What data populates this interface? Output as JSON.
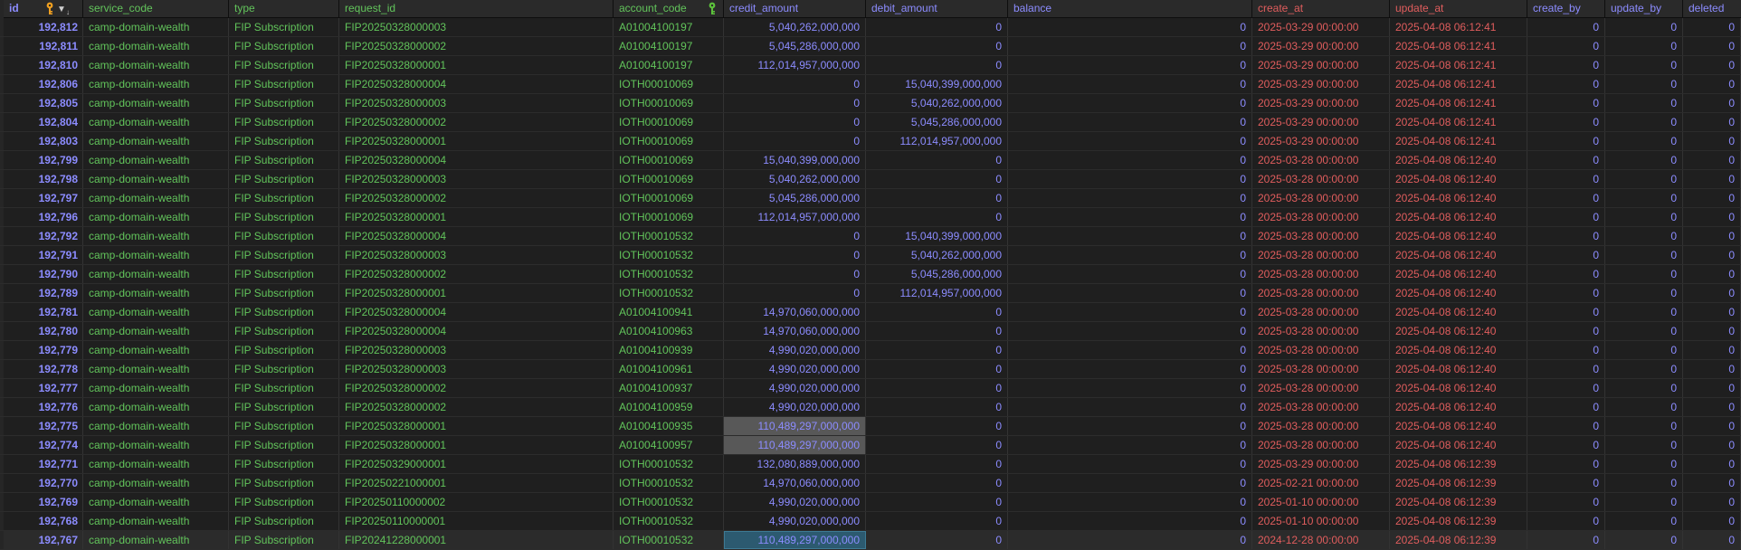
{
  "columns": [
    {
      "key": "id",
      "label": "id"
    },
    {
      "key": "service_code",
      "label": "service_code"
    },
    {
      "key": "type",
      "label": "type"
    },
    {
      "key": "request_id",
      "label": "request_id"
    },
    {
      "key": "account_code",
      "label": "account_code"
    },
    {
      "key": "credit_amount",
      "label": "credit_amount"
    },
    {
      "key": "debit_amount",
      "label": "debit_amount"
    },
    {
      "key": "balance",
      "label": "balance"
    },
    {
      "key": "create_at",
      "label": "create_at"
    },
    {
      "key": "update_at",
      "label": "update_at"
    },
    {
      "key": "create_by",
      "label": "create_by"
    },
    {
      "key": "update_by",
      "label": "update_by"
    },
    {
      "key": "deleted",
      "label": "deleted"
    }
  ],
  "icons": {
    "id_primary_key": "key-icon",
    "id_sort": "sort-descending-icon",
    "account_code_key": "key-icon"
  },
  "colors": {
    "number": "#8c8cff",
    "text": "#62c45b",
    "datetime": "#e05d5d",
    "primary_key_icon": "#f0a020",
    "foreign_key_icon": "#5cc23b",
    "selection_gray": "#585858",
    "selection_blue": "#2c5a70"
  },
  "rows": [
    {
      "id": "192,812",
      "service_code": "camp-domain-wealth",
      "type": "FIP Subscription",
      "request_id": "FIP20250328000003",
      "account_code": "A01004100197",
      "credit_amount": "5,040,262,000,000",
      "debit_amount": "0",
      "balance": "0",
      "create_at": "2025-03-29 00:00:00",
      "update_at": "2025-04-08 06:12:41",
      "create_by": "0",
      "update_by": "0",
      "deleted": "0"
    },
    {
      "id": "192,811",
      "service_code": "camp-domain-wealth",
      "type": "FIP Subscription",
      "request_id": "FIP20250328000002",
      "account_code": "A01004100197",
      "credit_amount": "5,045,286,000,000",
      "debit_amount": "0",
      "balance": "0",
      "create_at": "2025-03-29 00:00:00",
      "update_at": "2025-04-08 06:12:41",
      "create_by": "0",
      "update_by": "0",
      "deleted": "0"
    },
    {
      "id": "192,810",
      "service_code": "camp-domain-wealth",
      "type": "FIP Subscription",
      "request_id": "FIP20250328000001",
      "account_code": "A01004100197",
      "credit_amount": "112,014,957,000,000",
      "debit_amount": "0",
      "balance": "0",
      "create_at": "2025-03-29 00:00:00",
      "update_at": "2025-04-08 06:12:41",
      "create_by": "0",
      "update_by": "0",
      "deleted": "0"
    },
    {
      "id": "192,806",
      "service_code": "camp-domain-wealth",
      "type": "FIP Subscription",
      "request_id": "FIP20250328000004",
      "account_code": "IOTH00010069",
      "credit_amount": "0",
      "debit_amount": "15,040,399,000,000",
      "balance": "0",
      "create_at": "2025-03-29 00:00:00",
      "update_at": "2025-04-08 06:12:41",
      "create_by": "0",
      "update_by": "0",
      "deleted": "0"
    },
    {
      "id": "192,805",
      "service_code": "camp-domain-wealth",
      "type": "FIP Subscription",
      "request_id": "FIP20250328000003",
      "account_code": "IOTH00010069",
      "credit_amount": "0",
      "debit_amount": "5,040,262,000,000",
      "balance": "0",
      "create_at": "2025-03-29 00:00:00",
      "update_at": "2025-04-08 06:12:41",
      "create_by": "0",
      "update_by": "0",
      "deleted": "0"
    },
    {
      "id": "192,804",
      "service_code": "camp-domain-wealth",
      "type": "FIP Subscription",
      "request_id": "FIP20250328000002",
      "account_code": "IOTH00010069",
      "credit_amount": "0",
      "debit_amount": "5,045,286,000,000",
      "balance": "0",
      "create_at": "2025-03-29 00:00:00",
      "update_at": "2025-04-08 06:12:41",
      "create_by": "0",
      "update_by": "0",
      "deleted": "0"
    },
    {
      "id": "192,803",
      "service_code": "camp-domain-wealth",
      "type": "FIP Subscription",
      "request_id": "FIP20250328000001",
      "account_code": "IOTH00010069",
      "credit_amount": "0",
      "debit_amount": "112,014,957,000,000",
      "balance": "0",
      "create_at": "2025-03-29 00:00:00",
      "update_at": "2025-04-08 06:12:41",
      "create_by": "0",
      "update_by": "0",
      "deleted": "0"
    },
    {
      "id": "192,799",
      "service_code": "camp-domain-wealth",
      "type": "FIP Subscription",
      "request_id": "FIP20250328000004",
      "account_code": "IOTH00010069",
      "credit_amount": "15,040,399,000,000",
      "debit_amount": "0",
      "balance": "0",
      "create_at": "2025-03-28 00:00:00",
      "update_at": "2025-04-08 06:12:40",
      "create_by": "0",
      "update_by": "0",
      "deleted": "0"
    },
    {
      "id": "192,798",
      "service_code": "camp-domain-wealth",
      "type": "FIP Subscription",
      "request_id": "FIP20250328000003",
      "account_code": "IOTH00010069",
      "credit_amount": "5,040,262,000,000",
      "debit_amount": "0",
      "balance": "0",
      "create_at": "2025-03-28 00:00:00",
      "update_at": "2025-04-08 06:12:40",
      "create_by": "0",
      "update_by": "0",
      "deleted": "0"
    },
    {
      "id": "192,797",
      "service_code": "camp-domain-wealth",
      "type": "FIP Subscription",
      "request_id": "FIP20250328000002",
      "account_code": "IOTH00010069",
      "credit_amount": "5,045,286,000,000",
      "debit_amount": "0",
      "balance": "0",
      "create_at": "2025-03-28 00:00:00",
      "update_at": "2025-04-08 06:12:40",
      "create_by": "0",
      "update_by": "0",
      "deleted": "0"
    },
    {
      "id": "192,796",
      "service_code": "camp-domain-wealth",
      "type": "FIP Subscription",
      "request_id": "FIP20250328000001",
      "account_code": "IOTH00010069",
      "credit_amount": "112,014,957,000,000",
      "debit_amount": "0",
      "balance": "0",
      "create_at": "2025-03-28 00:00:00",
      "update_at": "2025-04-08 06:12:40",
      "create_by": "0",
      "update_by": "0",
      "deleted": "0"
    },
    {
      "id": "192,792",
      "service_code": "camp-domain-wealth",
      "type": "FIP Subscription",
      "request_id": "FIP20250328000004",
      "account_code": "IOTH00010532",
      "credit_amount": "0",
      "debit_amount": "15,040,399,000,000",
      "balance": "0",
      "create_at": "2025-03-28 00:00:00",
      "update_at": "2025-04-08 06:12:40",
      "create_by": "0",
      "update_by": "0",
      "deleted": "0"
    },
    {
      "id": "192,791",
      "service_code": "camp-domain-wealth",
      "type": "FIP Subscription",
      "request_id": "FIP20250328000003",
      "account_code": "IOTH00010532",
      "credit_amount": "0",
      "debit_amount": "5,040,262,000,000",
      "balance": "0",
      "create_at": "2025-03-28 00:00:00",
      "update_at": "2025-04-08 06:12:40",
      "create_by": "0",
      "update_by": "0",
      "deleted": "0"
    },
    {
      "id": "192,790",
      "service_code": "camp-domain-wealth",
      "type": "FIP Subscription",
      "request_id": "FIP20250328000002",
      "account_code": "IOTH00010532",
      "credit_amount": "0",
      "debit_amount": "5,045,286,000,000",
      "balance": "0",
      "create_at": "2025-03-28 00:00:00",
      "update_at": "2025-04-08 06:12:40",
      "create_by": "0",
      "update_by": "0",
      "deleted": "0"
    },
    {
      "id": "192,789",
      "service_code": "camp-domain-wealth",
      "type": "FIP Subscription",
      "request_id": "FIP20250328000001",
      "account_code": "IOTH00010532",
      "credit_amount": "0",
      "debit_amount": "112,014,957,000,000",
      "balance": "0",
      "create_at": "2025-03-28 00:00:00",
      "update_at": "2025-04-08 06:12:40",
      "create_by": "0",
      "update_by": "0",
      "deleted": "0"
    },
    {
      "id": "192,781",
      "service_code": "camp-domain-wealth",
      "type": "FIP Subscription",
      "request_id": "FIP20250328000004",
      "account_code": "A01004100941",
      "credit_amount": "14,970,060,000,000",
      "debit_amount": "0",
      "balance": "0",
      "create_at": "2025-03-28 00:00:00",
      "update_at": "2025-04-08 06:12:40",
      "create_by": "0",
      "update_by": "0",
      "deleted": "0"
    },
    {
      "id": "192,780",
      "service_code": "camp-domain-wealth",
      "type": "FIP Subscription",
      "request_id": "FIP20250328000004",
      "account_code": "A01004100963",
      "credit_amount": "14,970,060,000,000",
      "debit_amount": "0",
      "balance": "0",
      "create_at": "2025-03-28 00:00:00",
      "update_at": "2025-04-08 06:12:40",
      "create_by": "0",
      "update_by": "0",
      "deleted": "0"
    },
    {
      "id": "192,779",
      "service_code": "camp-domain-wealth",
      "type": "FIP Subscription",
      "request_id": "FIP20250328000003",
      "account_code": "A01004100939",
      "credit_amount": "4,990,020,000,000",
      "debit_amount": "0",
      "balance": "0",
      "create_at": "2025-03-28 00:00:00",
      "update_at": "2025-04-08 06:12:40",
      "create_by": "0",
      "update_by": "0",
      "deleted": "0"
    },
    {
      "id": "192,778",
      "service_code": "camp-domain-wealth",
      "type": "FIP Subscription",
      "request_id": "FIP20250328000003",
      "account_code": "A01004100961",
      "credit_amount": "4,990,020,000,000",
      "debit_amount": "0",
      "balance": "0",
      "create_at": "2025-03-28 00:00:00",
      "update_at": "2025-04-08 06:12:40",
      "create_by": "0",
      "update_by": "0",
      "deleted": "0"
    },
    {
      "id": "192,777",
      "service_code": "camp-domain-wealth",
      "type": "FIP Subscription",
      "request_id": "FIP20250328000002",
      "account_code": "A01004100937",
      "credit_amount": "4,990,020,000,000",
      "debit_amount": "0",
      "balance": "0",
      "create_at": "2025-03-28 00:00:00",
      "update_at": "2025-04-08 06:12:40",
      "create_by": "0",
      "update_by": "0",
      "deleted": "0"
    },
    {
      "id": "192,776",
      "service_code": "camp-domain-wealth",
      "type": "FIP Subscription",
      "request_id": "FIP20250328000002",
      "account_code": "A01004100959",
      "credit_amount": "4,990,020,000,000",
      "debit_amount": "0",
      "balance": "0",
      "create_at": "2025-03-28 00:00:00",
      "update_at": "2025-04-08 06:12:40",
      "create_by": "0",
      "update_by": "0",
      "deleted": "0"
    },
    {
      "id": "192,775",
      "service_code": "camp-domain-wealth",
      "type": "FIP Subscription",
      "request_id": "FIP20250328000001",
      "account_code": "A01004100935",
      "credit_amount": "110,489,297,000,000",
      "debit_amount": "0",
      "balance": "0",
      "create_at": "2025-03-28 00:00:00",
      "update_at": "2025-04-08 06:12:40",
      "create_by": "0",
      "update_by": "0",
      "deleted": "0",
      "credit_highlight": "gray"
    },
    {
      "id": "192,774",
      "service_code": "camp-domain-wealth",
      "type": "FIP Subscription",
      "request_id": "FIP20250328000001",
      "account_code": "A01004100957",
      "credit_amount": "110,489,297,000,000",
      "debit_amount": "0",
      "balance": "0",
      "create_at": "2025-03-28 00:00:00",
      "update_at": "2025-04-08 06:12:40",
      "create_by": "0",
      "update_by": "0",
      "deleted": "0",
      "credit_highlight": "gray"
    },
    {
      "id": "192,771",
      "service_code": "camp-domain-wealth",
      "type": "FIP Subscription",
      "request_id": "FIP20250329000001",
      "account_code": "IOTH00010532",
      "credit_amount": "132,080,889,000,000",
      "debit_amount": "0",
      "balance": "0",
      "create_at": "2025-03-29 00:00:00",
      "update_at": "2025-04-08 06:12:39",
      "create_by": "0",
      "update_by": "0",
      "deleted": "0"
    },
    {
      "id": "192,770",
      "service_code": "camp-domain-wealth",
      "type": "FIP Subscription",
      "request_id": "FIP20250221000001",
      "account_code": "IOTH00010532",
      "credit_amount": "14,970,060,000,000",
      "debit_amount": "0",
      "balance": "0",
      "create_at": "2025-02-21 00:00:00",
      "update_at": "2025-04-08 06:12:39",
      "create_by": "0",
      "update_by": "0",
      "deleted": "0"
    },
    {
      "id": "192,769",
      "service_code": "camp-domain-wealth",
      "type": "FIP Subscription",
      "request_id": "FIP20250110000002",
      "account_code": "IOTH00010532",
      "credit_amount": "4,990,020,000,000",
      "debit_amount": "0",
      "balance": "0",
      "create_at": "2025-01-10 00:00:00",
      "update_at": "2025-04-08 06:12:39",
      "create_by": "0",
      "update_by": "0",
      "deleted": "0"
    },
    {
      "id": "192,768",
      "service_code": "camp-domain-wealth",
      "type": "FIP Subscription",
      "request_id": "FIP20250110000001",
      "account_code": "IOTH00010532",
      "credit_amount": "4,990,020,000,000",
      "debit_amount": "0",
      "balance": "0",
      "create_at": "2025-01-10 00:00:00",
      "update_at": "2025-04-08 06:12:39",
      "create_by": "0",
      "update_by": "0",
      "deleted": "0"
    },
    {
      "id": "192,767",
      "service_code": "camp-domain-wealth",
      "type": "FIP Subscription",
      "request_id": "FIP20241228000001",
      "account_code": "IOTH00010532",
      "credit_amount": "110,489,297,000,000",
      "debit_amount": "0",
      "balance": "0",
      "create_at": "2024-12-28 00:00:00",
      "update_at": "2025-04-08 06:12:39",
      "create_by": "0",
      "update_by": "0",
      "deleted": "0",
      "credit_highlight": "blue",
      "selected": true
    }
  ]
}
